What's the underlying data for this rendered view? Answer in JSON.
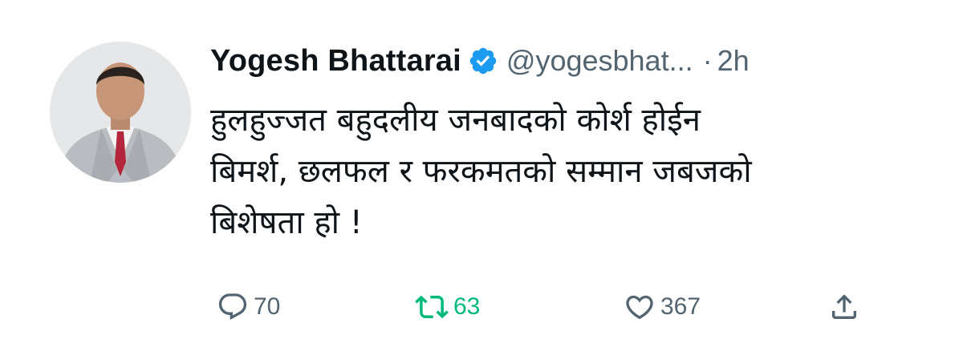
{
  "user": {
    "display_name": "Yogesh Bhattarai",
    "handle": "@yogesbhat...",
    "separator": "·",
    "time": "2h",
    "verified_icon": "verified-badge-icon"
  },
  "tweet": {
    "text": "हुलहुज्जत बहुदलीय जनबादको कोर्श होईन\nबिमर्श, छलफल र फरकमतको सम्मान जबजको\nबिशेषता हो  !"
  },
  "actions": {
    "reply": {
      "icon": "reply-icon",
      "count": "70"
    },
    "retweet": {
      "icon": "retweet-icon",
      "count": "63"
    },
    "like": {
      "icon": "heart-icon",
      "count": "367"
    },
    "share": {
      "icon": "share-icon"
    }
  },
  "colors": {
    "text": "#0f1419",
    "secondary": "#536471",
    "verified": "#1d9bf0",
    "retweet_active": "#00ba7c"
  }
}
